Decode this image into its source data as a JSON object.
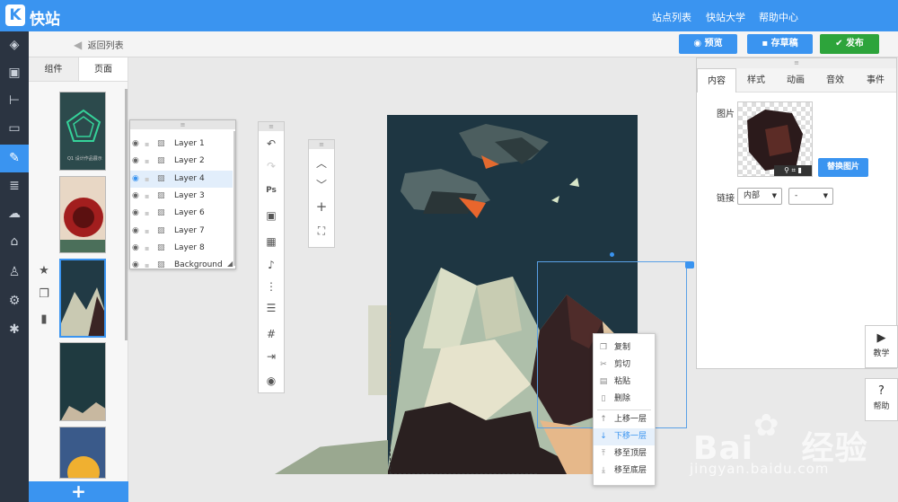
{
  "header": {
    "title": "快站",
    "logo_letter": "K",
    "nav": [
      "站点列表",
      "快站大学",
      "帮助中心"
    ]
  },
  "toolbar": {
    "back": "返回列表",
    "preview": "预览",
    "save_draft": "存草稿",
    "publish": "发布"
  },
  "left_tabs": [
    "组件",
    "页面"
  ],
  "thumb_caption": "Q1 设计作品展示",
  "layers": [
    "Layer 1",
    "Layer 2",
    "Layer 4",
    "Layer 3",
    "Layer 6",
    "Layer 7",
    "Layer 8",
    "Background"
  ],
  "selected_layer": "Layer 4",
  "context_menu": [
    "复制",
    "剪切",
    "粘贴",
    "删除",
    "上移一层",
    "下移一层",
    "移至顶层",
    "移至底层"
  ],
  "highlighted_menu_item": "下移一层",
  "props": {
    "tabs": [
      "内容",
      "样式",
      "动画",
      "音效",
      "事件"
    ],
    "image_label": "图片",
    "replace_button": "替换图片",
    "link_label": "链接",
    "link_type": "内部",
    "link_target": "-"
  },
  "help": {
    "tutorial": "教学",
    "help": "帮助"
  },
  "watermark": {
    "brand": "Bai",
    "brand_tail": "经验",
    "url": "jingyan.baidu.com"
  },
  "colors": {
    "accent": "#3a94f0",
    "publish": "#2da43b",
    "rail": "#2b3441"
  }
}
